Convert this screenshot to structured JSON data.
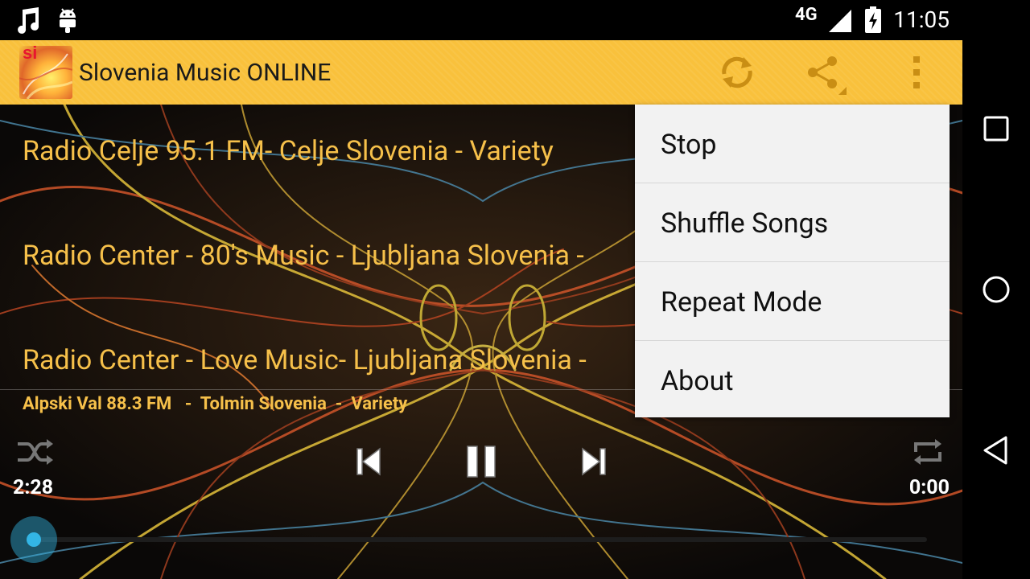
{
  "status_bar": {
    "network": "4G",
    "time": "11:05",
    "icons": [
      "music-note-icon",
      "android-icon",
      "signal-icon",
      "battery-charging-icon"
    ]
  },
  "action_bar": {
    "title": "Slovenia Music ONLINE",
    "logo_text": "si",
    "icons": [
      "refresh-icon",
      "share-icon",
      "overflow-menu-icon"
    ],
    "accent_color": "#f9c13c"
  },
  "stations": [
    {
      "label": "Radio Celje 95.1 FM- Celje Slovenia  - Variety"
    },
    {
      "label": "Radio Center - 80's Music  - Ljubljana Slovenia -"
    },
    {
      "label": "Radio Center - Love Music- Ljubljana Slovenia -"
    }
  ],
  "player": {
    "now_playing": "Alpski Val 88.3 FM   -  Tolmin Slovenia  -  Variety",
    "time_elapsed": "2:28",
    "time_total": "0:00",
    "text_color": "#f6c04a",
    "seek_color": "#33b5e5",
    "controls": [
      "shuffle-icon",
      "previous-icon",
      "pause-icon",
      "next-icon",
      "repeat-icon"
    ]
  },
  "menu": {
    "items": [
      {
        "label": "Stop"
      },
      {
        "label": "Shuffle Songs"
      },
      {
        "label": "Repeat Mode"
      },
      {
        "label": "About"
      }
    ]
  },
  "nav_bar": {
    "icons": [
      "recents-icon",
      "home-icon",
      "back-icon"
    ]
  }
}
